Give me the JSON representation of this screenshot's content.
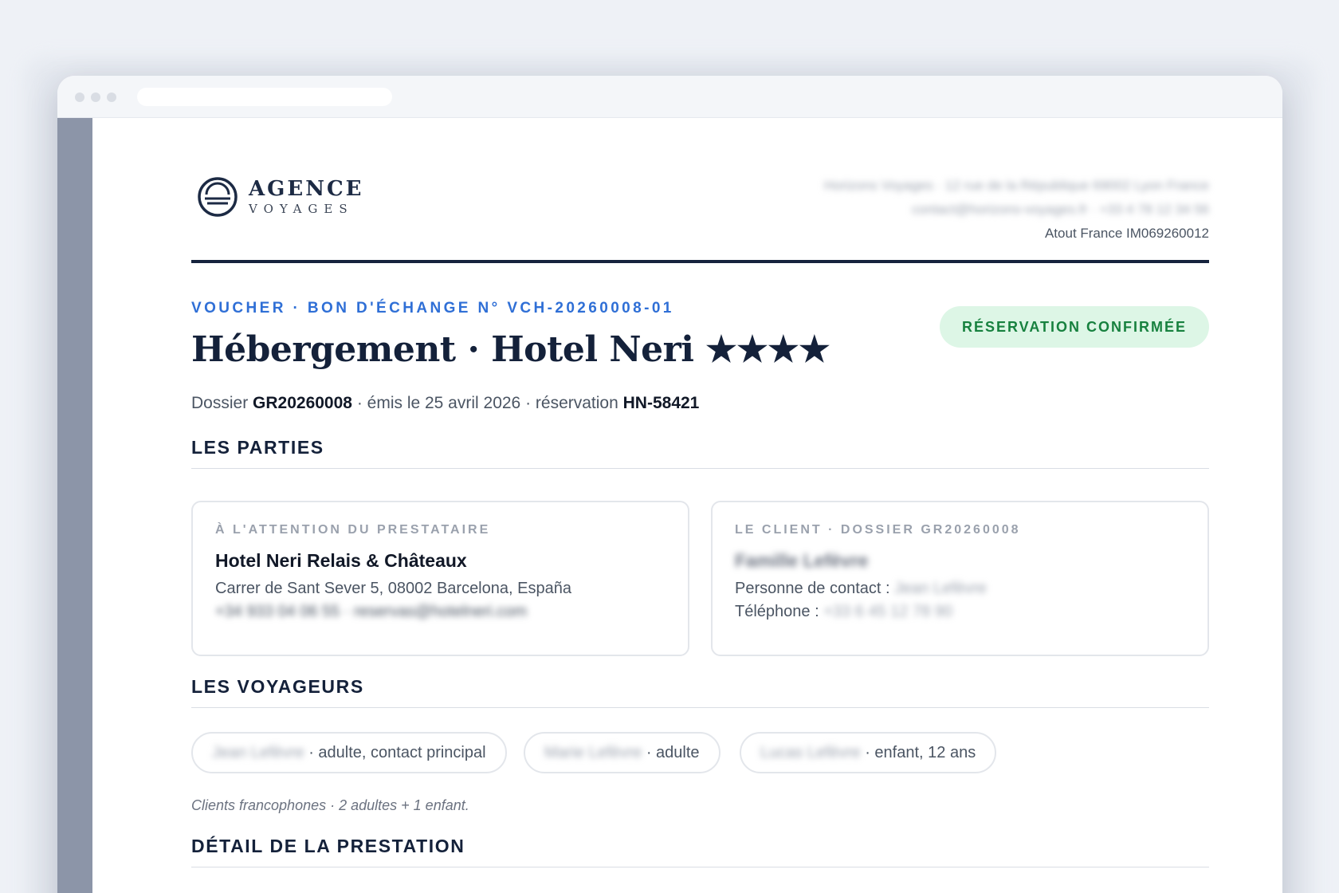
{
  "agency": {
    "logo_name": "AGENCE",
    "logo_sub": "VOYAGES",
    "address_line": "Horizons Voyages · 12 rue de la République 69002 Lyon France",
    "contact_line": "contact@horizons-voyages.fr · +33 4 78 12 34 56",
    "license": "Atout France IM069260012"
  },
  "voucher": {
    "kicker": "VOUCHER · BON D'ÉCHANGE N° VCH-20260008-01",
    "title": "Hébergement · Hotel Neri ★★★★",
    "status_badge": "RÉSERVATION CONFIRMÉE",
    "meta": {
      "dossier_label": "Dossier",
      "dossier_value": "GR20260008",
      "issued_text": "· émis le 25 avril 2026 · réservation",
      "reservation_value": "HN-58421"
    }
  },
  "parties": {
    "section_title": "LES PARTIES",
    "provider": {
      "label": "À L'ATTENTION DU PRESTATAIRE",
      "name": "Hotel Neri Relais & Châteaux",
      "address": "Carrer de Sant Sever 5, 08002 Barcelona, España",
      "contact": "+34 933 04 06 55 · reservas@hotelneri.com"
    },
    "client": {
      "label": "LE CLIENT · DOSSIER GR20260008",
      "name": "Famille Lefèvre",
      "contact_label": "Personne de contact :",
      "contact_value": "Jean Lefèvre",
      "phone_label": "Téléphone :",
      "phone_value": "+33 6 45 12 78 90"
    }
  },
  "travellers": {
    "section_title": "LES VOYAGEURS",
    "chips": [
      {
        "name": "Jean Lefèvre",
        "role": "· adulte, contact principal"
      },
      {
        "name": "Marie Lefèvre",
        "role": "· adulte"
      },
      {
        "name": "Lucas Lefèvre",
        "role": "· enfant, 12 ans"
      }
    ],
    "note": "Clients francophones · 2 adultes + 1 enfant."
  },
  "service": {
    "section_title": "DÉTAIL DE LA PRESTATION"
  },
  "colors": {
    "accent": "#2f6fd6",
    "navy": "#14213a",
    "success_bg": "#ddf6e6",
    "success_text": "#17813f"
  }
}
